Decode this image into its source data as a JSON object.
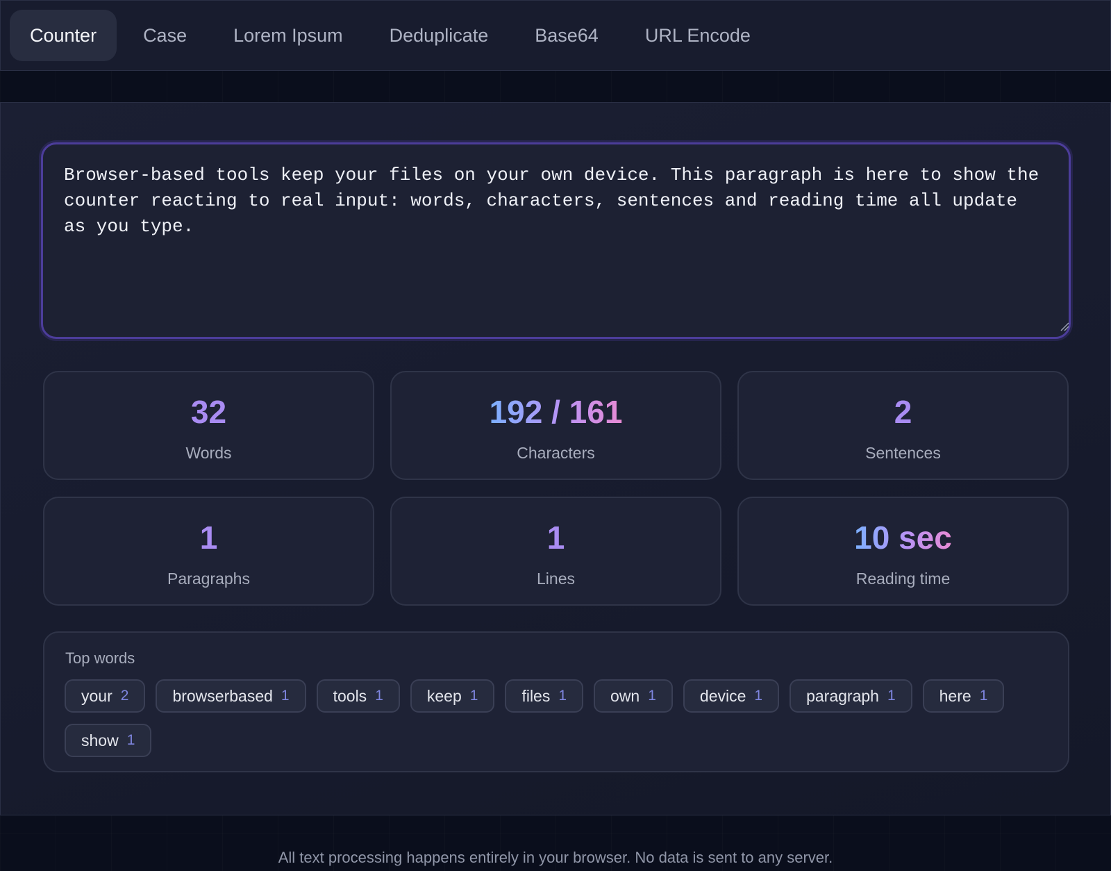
{
  "tabs": [
    {
      "label": "Counter",
      "active": true
    },
    {
      "label": "Case"
    },
    {
      "label": "Lorem Ipsum"
    },
    {
      "label": "Deduplicate"
    },
    {
      "label": "Base64"
    },
    {
      "label": "URL Encode"
    }
  ],
  "editor": {
    "value": "Browser-based tools keep your files on your own device. This paragraph is here to show the counter reacting to real input: words, characters, sentences and reading time all update as you type."
  },
  "stats": {
    "words": {
      "value": "32",
      "label": "Words"
    },
    "characters": {
      "value": "192 / 161",
      "label": "Characters"
    },
    "sentences": {
      "value": "2",
      "label": "Sentences"
    },
    "paragraphs": {
      "value": "1",
      "label": "Paragraphs"
    },
    "lines": {
      "value": "1",
      "label": "Lines"
    },
    "reading_time": {
      "value": "10 sec",
      "label": "Reading time"
    }
  },
  "top_words": {
    "title": "Top words",
    "items": [
      {
        "word": "your",
        "count": "2"
      },
      {
        "word": "browserbased",
        "count": "1"
      },
      {
        "word": "tools",
        "count": "1"
      },
      {
        "word": "keep",
        "count": "1"
      },
      {
        "word": "files",
        "count": "1"
      },
      {
        "word": "own",
        "count": "1"
      },
      {
        "word": "device",
        "count": "1"
      },
      {
        "word": "paragraph",
        "count": "1"
      },
      {
        "word": "here",
        "count": "1"
      },
      {
        "word": "show",
        "count": "1"
      }
    ]
  },
  "footer": {
    "text": "All text processing happens entirely in your browser. No data is sent to any server."
  },
  "colors": {
    "accent_border": "#4c3d9a",
    "gradient_start": "#7cb0ff",
    "gradient_mid": "#b993f5",
    "gradient_end": "#e88bd4",
    "count_color": "#7f86e0"
  }
}
